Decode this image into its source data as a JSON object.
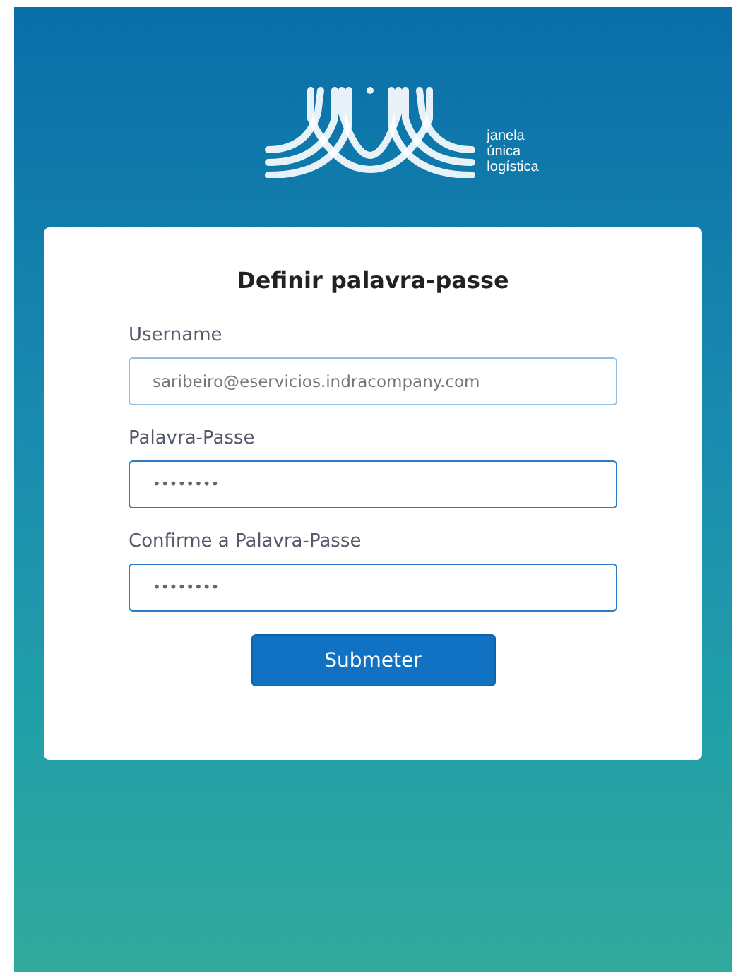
{
  "logo": {
    "lines": [
      "janela",
      "única",
      "logística"
    ]
  },
  "form": {
    "title": "Definir palavra-passe",
    "fields": [
      {
        "label": "Username",
        "kind": "text",
        "value": "saribeiro@eservicios.indracompany.com"
      },
      {
        "label": "Palavra-Passe",
        "kind": "password",
        "value": "••••••••"
      },
      {
        "label": "Confirme a Palavra-Passe",
        "kind": "password",
        "value": "••••••••"
      }
    ],
    "button": "Submeter"
  }
}
